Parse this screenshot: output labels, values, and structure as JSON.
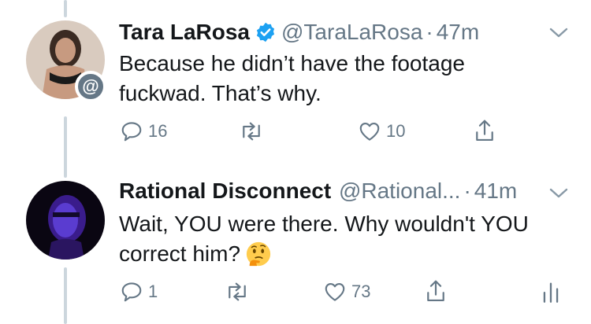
{
  "tweets": [
    {
      "display_name": "Tara LaRosa",
      "handle": "@TaraLaRosa",
      "separator": "·",
      "time": "47m",
      "verified": true,
      "text": "Because he didn’t have the footage fuckwad. That’s why.",
      "badge": "@",
      "replies": "16",
      "retweets": "",
      "likes": "10"
    },
    {
      "display_name": "Rational Disconnect",
      "handle": "@Rational...",
      "separator": "·",
      "time": "41m",
      "verified": false,
      "text": "Wait, YOU were there. Why wouldn't YOU correct him?",
      "emoji": "thinking-face",
      "replies": "1",
      "retweets": "",
      "likes": "73"
    }
  ],
  "colors": {
    "text": "#14171a",
    "meta": "#657786",
    "verified": "#1da1f2",
    "thread_line": "#ccd6dd"
  },
  "icons": [
    "reply-icon",
    "retweet-icon",
    "like-icon",
    "share-icon",
    "analytics-icon",
    "chevron-down-icon",
    "verified-icon"
  ]
}
